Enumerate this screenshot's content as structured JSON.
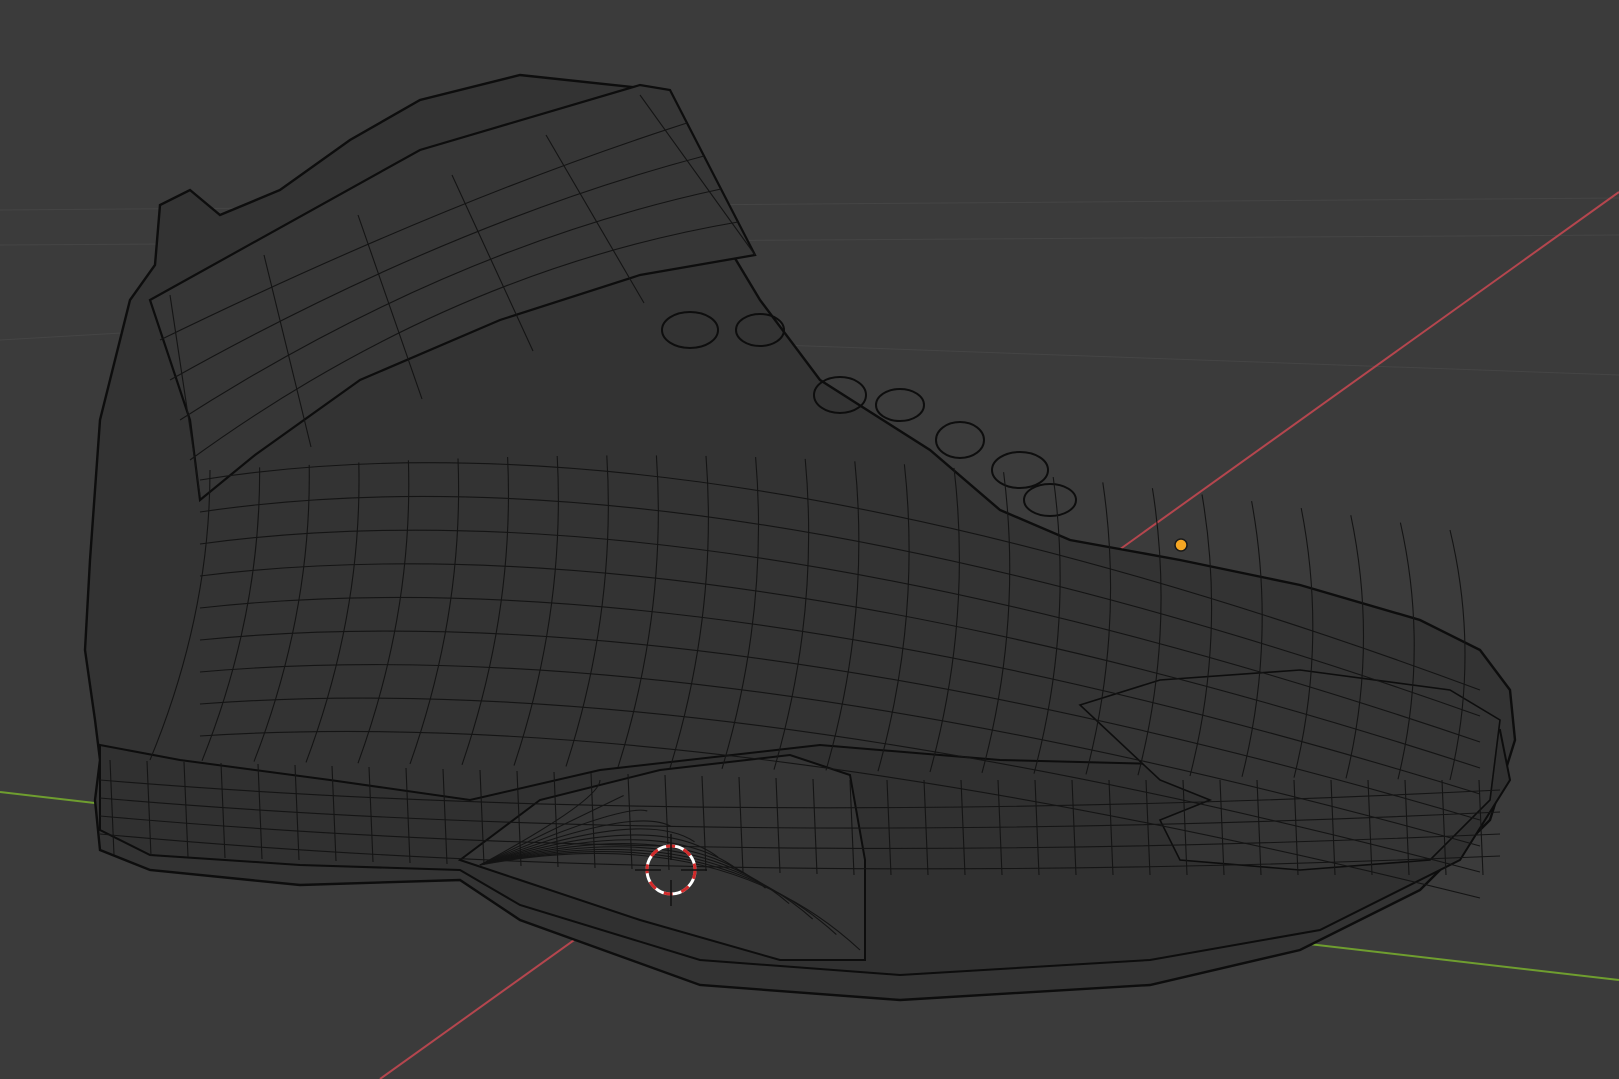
{
  "viewport": {
    "background": "#3b3b3b",
    "mesh_fill": "#333333",
    "mesh_wire": "#141414",
    "axis_x_color": "#b4464e",
    "axis_y_color": "#6f9e2f",
    "origin_color": "#f5a623",
    "cursor_primary": "#d22a2a",
    "cursor_secondary": "#ffffff",
    "object": "sneaker-wireframe-mesh",
    "icons": [
      "3d-cursor-icon",
      "object-origin-icon"
    ]
  }
}
